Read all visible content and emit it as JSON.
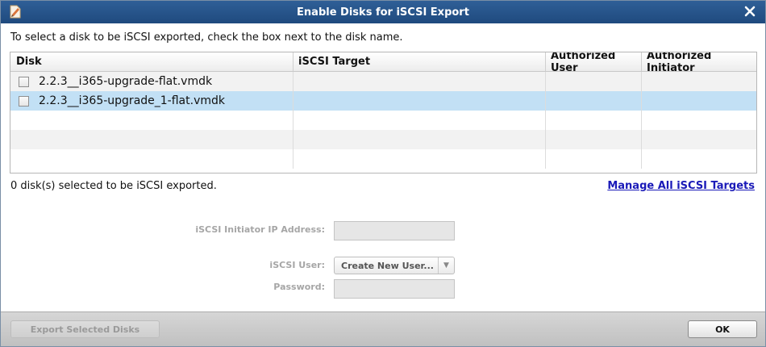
{
  "window": {
    "title": "Enable Disks for iSCSI Export",
    "app_icon": "app-logo-icon",
    "close_icon": "close-icon"
  },
  "instructions": "To select a disk to be iSCSI exported, check the box next to the disk name.",
  "table": {
    "columns": [
      "Disk",
      "iSCSI Target",
      "Authorized User",
      "Authorized Initiator"
    ],
    "rows": [
      {
        "disk": "2.2.3__i365-upgrade-flat.vmdk",
        "target": "",
        "user": "",
        "initiator": "",
        "checked": false
      },
      {
        "disk": "2.2.3__i365-upgrade_1-flat.vmdk",
        "target": "",
        "user": "",
        "initiator": "",
        "checked": false,
        "selected": true
      }
    ]
  },
  "status_text": "0 disk(s) selected to be iSCSI exported.",
  "manage_link": "Manage All iSCSI Targets",
  "form": {
    "initiator_ip_label": "iSCSI Initiator IP Address:",
    "initiator_ip_value": "",
    "user_label": "iSCSI User:",
    "user_selected": "Create New User...",
    "password_label": "Password:",
    "password_value": ""
  },
  "buttons": {
    "export_label": "Export Selected Disks",
    "ok_label": "OK"
  },
  "colors": {
    "titlebar": "#1f4a7e",
    "selected_row": "#c2e0f5",
    "link": "#1a1ab8"
  }
}
